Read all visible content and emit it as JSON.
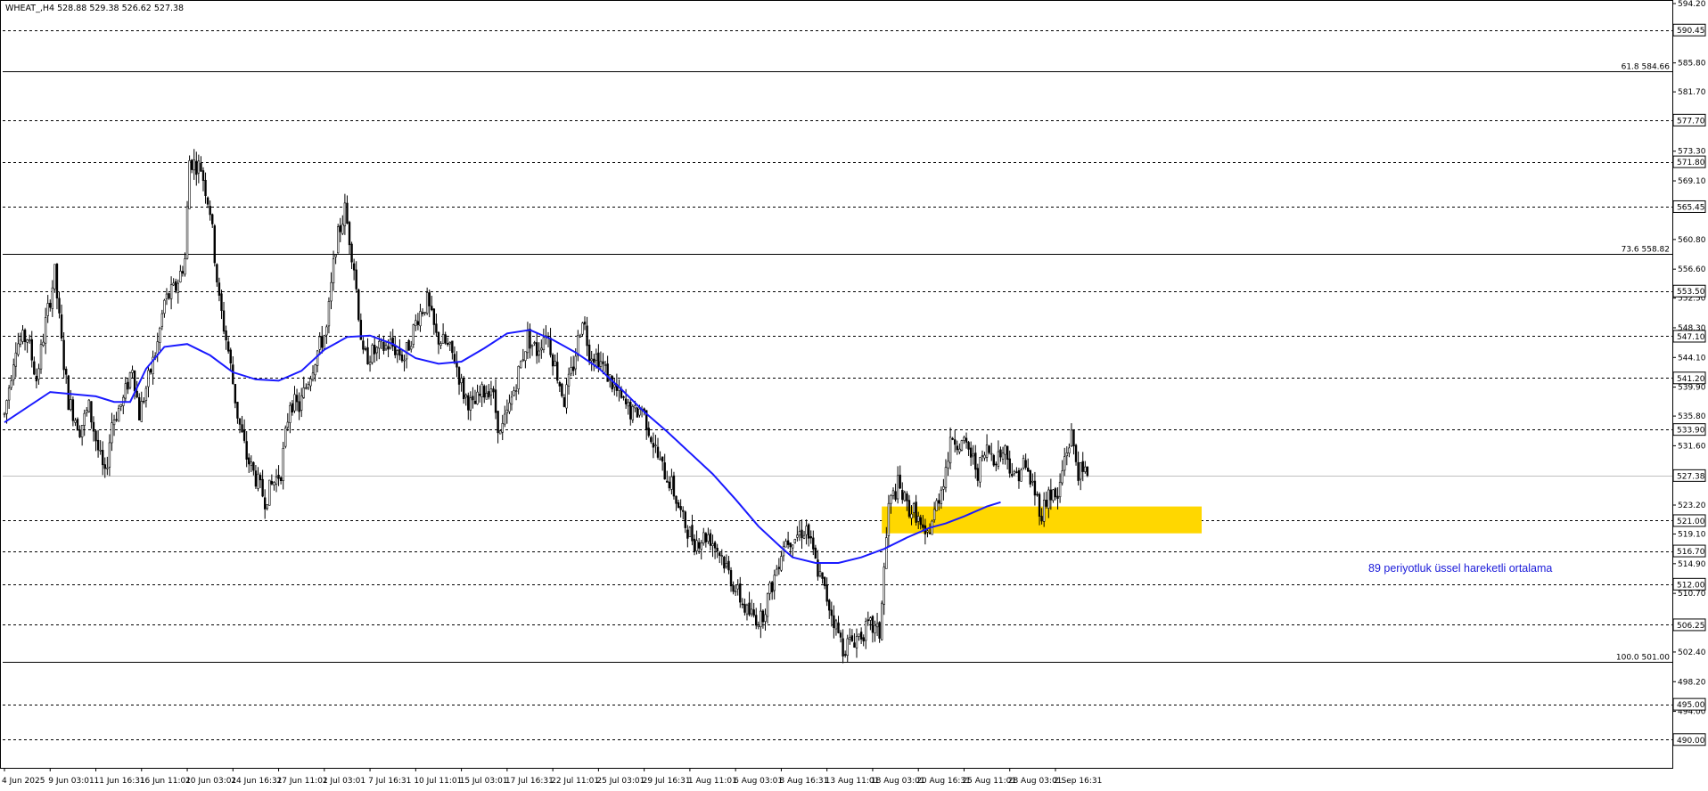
{
  "header": {
    "symbol_title": "WHEAT_,H4  528.88 529.38 526.62 527.38"
  },
  "annotation": {
    "ema_label": "89 periyotluk üssel hareketli ortalama"
  },
  "colors": {
    "background": "#ffffff",
    "candle": "#000000",
    "ema": "#1a1aff",
    "zone": "#ffd700",
    "grid": "#000000",
    "current_price_line": "#c0c0c0",
    "ema_text": "#1a1ad9"
  },
  "chart_data": {
    "type": "candlestick",
    "symbol": "WHEAT_",
    "timeframe": "H4",
    "ohlc_last": {
      "open": 528.88,
      "high": 529.38,
      "low": 526.62,
      "close": 527.38
    },
    "ylim": [
      486.0,
      594.2
    ],
    "y_ticks": [
      594.2,
      585.8,
      581.7,
      573.3,
      569.1,
      560.8,
      556.6,
      552.5,
      548.3,
      544.1,
      539.9,
      535.8,
      531.6,
      523.2,
      519.1,
      514.9,
      510.7,
      502.4,
      498.2,
      494.0
    ],
    "x_tick_labels": [
      "4 Jun 2025",
      "9 Jun 03:01",
      "11 Jun 16:31",
      "16 Jun 11:01",
      "20 Jun 03:01",
      "24 Jun 16:31",
      "27 Jun 11:01",
      "2 Jul 03:01",
      "7 Jul 16:31",
      "10 Jul 11:01",
      "15 Jul 03:01",
      "17 Jul 16:31",
      "22 Jul 11:01",
      "25 Jul 03:01",
      "29 Jul 16:31",
      "1 Aug 11:01",
      "6 Aug 03:01",
      "8 Aug 16:31",
      "13 Aug 11:01",
      "18 Aug 03:01",
      "20 Aug 16:31",
      "25 Aug 11:01",
      "28 Aug 03:01",
      "2 Sep 16:31"
    ],
    "x_tick_index": [
      0,
      20,
      40,
      60,
      80,
      100,
      120,
      140,
      160,
      180,
      200,
      220,
      240,
      260,
      280,
      300,
      320,
      340,
      360,
      380,
      400,
      420,
      440,
      460
    ],
    "total_bars": 475,
    "horizontal_levels": [
      {
        "price": 590.45,
        "label": "590.45",
        "style": "dashed"
      },
      {
        "price": 584.66,
        "label": "",
        "style": "solid",
        "fib_text": "61.8 584.66"
      },
      {
        "price": 577.7,
        "label": "577.70",
        "style": "dashed"
      },
      {
        "price": 571.8,
        "label": "571.80",
        "style": "dashed"
      },
      {
        "price": 565.45,
        "label": "565.45",
        "style": "dashed"
      },
      {
        "price": 558.82,
        "label": "",
        "style": "solid",
        "fib_text": "73.6 558.82"
      },
      {
        "price": 553.5,
        "label": "553.50",
        "style": "dashed"
      },
      {
        "price": 547.1,
        "label": "547.10",
        "style": "dashed"
      },
      {
        "price": 541.2,
        "label": "541.20",
        "style": "dashed"
      },
      {
        "price": 533.9,
        "label": "533.90",
        "style": "dashed"
      },
      {
        "price": 527.38,
        "label": "527.38",
        "style": "current"
      },
      {
        "price": 521.0,
        "label": "521.00",
        "style": "dashed"
      },
      {
        "price": 516.7,
        "label": "516.70",
        "style": "dashed"
      },
      {
        "price": 512.0,
        "label": "512.00",
        "style": "dashed"
      },
      {
        "price": 506.25,
        "label": "506.25",
        "style": "dashed"
      },
      {
        "price": 501.0,
        "label": "",
        "style": "solid",
        "fib_text": "100.0 501.00"
      },
      {
        "price": 495.0,
        "label": "495.00",
        "style": "dashed"
      },
      {
        "price": 490.0,
        "label": "490.00",
        "style": "dashed"
      }
    ],
    "support_zone": {
      "price_top": 523.0,
      "price_bottom": 519.2,
      "bar_start": 384,
      "bar_end": 524
    },
    "price_path": [
      [
        0,
        536
      ],
      [
        5,
        546
      ],
      [
        10,
        547
      ],
      [
        14,
        541
      ],
      [
        18,
        549
      ],
      [
        22,
        556
      ],
      [
        25,
        546
      ],
      [
        28,
        538
      ],
      [
        33,
        534
      ],
      [
        37,
        537
      ],
      [
        41,
        531
      ],
      [
        44,
        527
      ],
      [
        47,
        535
      ],
      [
        52,
        538
      ],
      [
        56,
        543
      ],
      [
        59,
        536
      ],
      [
        63,
        541
      ],
      [
        67,
        546
      ],
      [
        70,
        552
      ],
      [
        75,
        554
      ],
      [
        79,
        558
      ],
      [
        81,
        572
      ],
      [
        86,
        571
      ],
      [
        90,
        565
      ],
      [
        94,
        552
      ],
      [
        98,
        545
      ],
      [
        102,
        536
      ],
      [
        106,
        530
      ],
      [
        110,
        527
      ],
      [
        114,
        524
      ],
      [
        117,
        526
      ],
      [
        121,
        528
      ],
      [
        125,
        538
      ],
      [
        129,
        537
      ],
      [
        133,
        541
      ],
      [
        137,
        545
      ],
      [
        141,
        548
      ],
      [
        145,
        560
      ],
      [
        149,
        565
      ],
      [
        153,
        557
      ],
      [
        157,
        544
      ],
      [
        163,
        545
      ],
      [
        169,
        546
      ],
      [
        175,
        544
      ],
      [
        181,
        550
      ],
      [
        185,
        552
      ],
      [
        189,
        547
      ],
      [
        193,
        546
      ],
      [
        197,
        544
      ],
      [
        201,
        539
      ],
      [
        205,
        537
      ],
      [
        209,
        539
      ],
      [
        213,
        540
      ],
      [
        217,
        533
      ],
      [
        221,
        537
      ],
      [
        225,
        542
      ],
      [
        229,
        547
      ],
      [
        233,
        545
      ],
      [
        237,
        548
      ],
      [
        241,
        543
      ],
      [
        245,
        538
      ],
      [
        249,
        543
      ],
      [
        253,
        550
      ],
      [
        256,
        545
      ],
      [
        260,
        544
      ],
      [
        265,
        541
      ],
      [
        270,
        538
      ],
      [
        275,
        536
      ],
      [
        279,
        537
      ],
      [
        283,
        533
      ],
      [
        287,
        529
      ],
      [
        292,
        526
      ],
      [
        297,
        521
      ],
      [
        302,
        518
      ],
      [
        308,
        519
      ],
      [
        314,
        516
      ],
      [
        319,
        512
      ],
      [
        325,
        508
      ],
      [
        331,
        507
      ],
      [
        337,
        513
      ],
      [
        341,
        518
      ],
      [
        347,
        519
      ],
      [
        351,
        520
      ],
      [
        355,
        515
      ],
      [
        359,
        511
      ],
      [
        363,
        507
      ],
      [
        367,
        503
      ],
      [
        371,
        504
      ],
      [
        375,
        505
      ],
      [
        379,
        506
      ],
      [
        383,
        505
      ],
      [
        387,
        523
      ],
      [
        391,
        526
      ],
      [
        395,
        523
      ],
      [
        399,
        522
      ],
      [
        403,
        518
      ],
      [
        407,
        522
      ],
      [
        411,
        527
      ],
      [
        415,
        533
      ],
      [
        418,
        532
      ],
      [
        422,
        531
      ],
      [
        426,
        528
      ],
      [
        430,
        531
      ],
      [
        434,
        530
      ],
      [
        438,
        531
      ],
      [
        442,
        527
      ],
      [
        446,
        529
      ],
      [
        450,
        526
      ],
      [
        454,
        522
      ],
      [
        457,
        525
      ],
      [
        461,
        524
      ],
      [
        464,
        530
      ],
      [
        467,
        533
      ],
      [
        470,
        528
      ],
      [
        474,
        527.38
      ]
    ],
    "ema89": [
      [
        0,
        534.9
      ],
      [
        20,
        539.2
      ],
      [
        40,
        538.6
      ],
      [
        48,
        537.8
      ],
      [
        55,
        537.8
      ],
      [
        62,
        542.5
      ],
      [
        70,
        545.6
      ],
      [
        80,
        546.0
      ],
      [
        90,
        544.4
      ],
      [
        100,
        542.0
      ],
      [
        110,
        541.0
      ],
      [
        120,
        540.8
      ],
      [
        130,
        542.2
      ],
      [
        140,
        545.2
      ],
      [
        150,
        547.0
      ],
      [
        160,
        547.2
      ],
      [
        170,
        546.0
      ],
      [
        180,
        544.0
      ],
      [
        190,
        543.2
      ],
      [
        200,
        543.5
      ],
      [
        210,
        545.4
      ],
      [
        220,
        547.5
      ],
      [
        230,
        548.0
      ],
      [
        240,
        546.6
      ],
      [
        250,
        544.8
      ],
      [
        260,
        542.6
      ],
      [
        270,
        539.6
      ],
      [
        280,
        536.4
      ],
      [
        290,
        533.6
      ],
      [
        300,
        530.6
      ],
      [
        310,
        527.6
      ],
      [
        320,
        524.0
      ],
      [
        330,
        520.2
      ],
      [
        340,
        517.2
      ],
      [
        345,
        515.8
      ],
      [
        355,
        515.0
      ],
      [
        365,
        515.0
      ],
      [
        375,
        515.8
      ],
      [
        385,
        517.0
      ],
      [
        395,
        518.6
      ],
      [
        405,
        520.0
      ],
      [
        412,
        520.6
      ],
      [
        420,
        521.6
      ],
      [
        430,
        523.0
      ],
      [
        436,
        523.6
      ]
    ]
  }
}
